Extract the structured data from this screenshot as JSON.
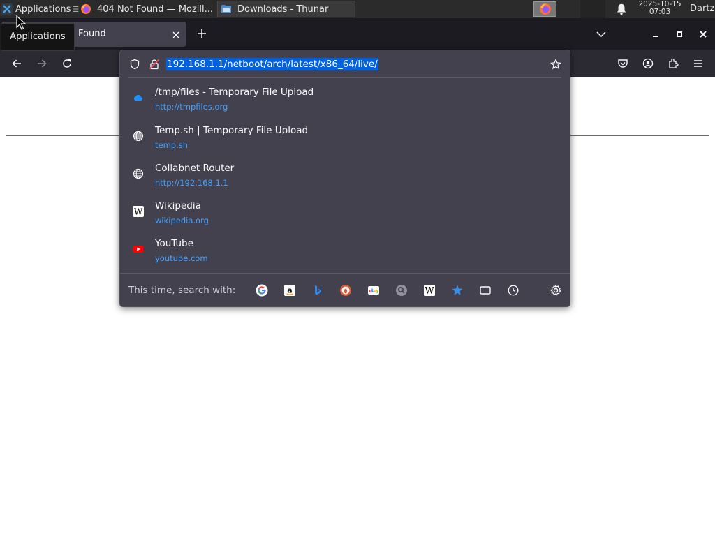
{
  "panel": {
    "apps_label": "Applications",
    "task1_label": "404 Not Found — Mozill...",
    "task2_label": "Downloads - Thunar",
    "clock_date": "2025-10-15",
    "clock_time": "07:03",
    "user": "Dartz"
  },
  "tooltip": "Applications",
  "tab": {
    "title": "Found"
  },
  "urlbar": {
    "url": "192.168.1.1/netboot/arch/latest/x86_64/live/",
    "results": [
      {
        "title": "/tmp/files - Temporary File Upload",
        "url": "http://tmpfiles.org",
        "icon": "cloud-icon"
      },
      {
        "title": "Temp.sh | Temporary File Upload",
        "url": "temp.sh",
        "icon": "globe-icon"
      },
      {
        "title": "Collabnet Router",
        "url": "http://192.168.1.1",
        "icon": "globe-icon"
      },
      {
        "title": "Wikipedia",
        "url": "wikipedia.org",
        "icon": "wikipedia-icon"
      },
      {
        "title": "YouTube",
        "url": "youtube.com",
        "icon": "youtube-icon"
      }
    ],
    "search_with_label": "This time, search with:",
    "engines": [
      "google",
      "amazon",
      "bing",
      "duckduckgo",
      "ebay",
      "search",
      "wikipedia",
      "bookmarks",
      "tabs",
      "history"
    ]
  },
  "colors": {
    "accent": "#0061e0",
    "link": "#45a1ff",
    "popup_bg": "#42414d",
    "toolbar_bg": "#2b2a33",
    "tabstrip_bg": "#1c1b22"
  }
}
